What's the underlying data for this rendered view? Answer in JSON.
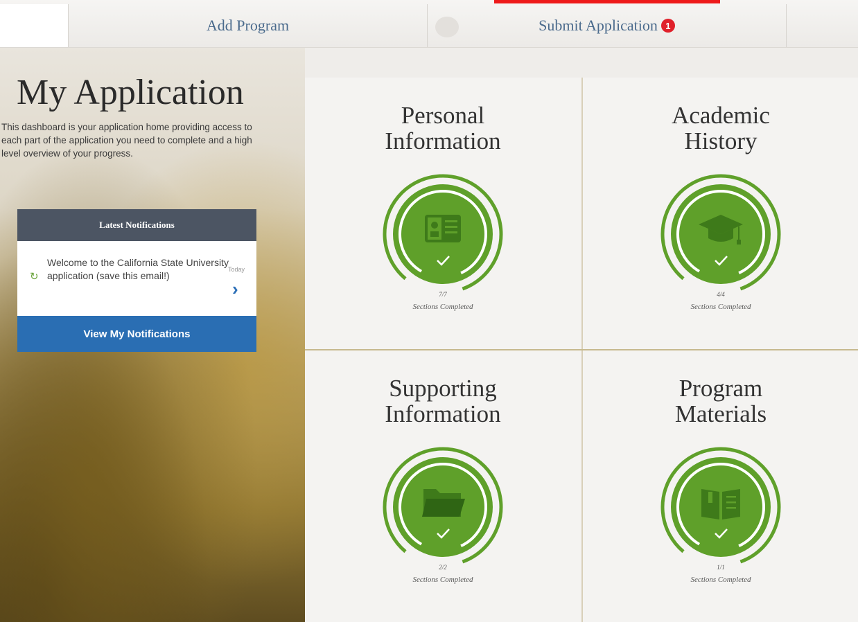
{
  "nav": {
    "tabs": [
      {
        "label": "Add Program"
      },
      {
        "label": "Submit Application",
        "badge": "1"
      }
    ],
    "highlight_color": "#ee1a1a"
  },
  "page": {
    "title": "My Application",
    "intro": "This dashboard is your application home providing access to each part of the application you need to complete and a high level overview of your progress."
  },
  "notifications": {
    "header": "Latest Notifications",
    "items": [
      {
        "text": "Welcome to the California State University application (save this email!)",
        "date": "Today",
        "icon": "refresh-icon"
      }
    ],
    "view_button": "View My Notifications"
  },
  "tiles": [
    {
      "title_line1": "Personal",
      "title_line2": "Information",
      "count": "7/7",
      "caption": "Sections Completed",
      "icon": "id-card-icon",
      "progress": 1.0
    },
    {
      "title_line1": "Academic",
      "title_line2": "History",
      "count": "4/4",
      "caption": "Sections Completed",
      "icon": "graduation-cap-icon",
      "progress": 1.0
    },
    {
      "title_line1": "Supporting",
      "title_line2": "Information",
      "count": "2/2",
      "caption": "Sections Completed",
      "icon": "folder-icon",
      "progress": 1.0
    },
    {
      "title_line1": "Program",
      "title_line2": "Materials",
      "count": "1/1",
      "caption": "Sections Completed",
      "icon": "book-icon",
      "progress": 1.0
    }
  ],
  "colors": {
    "accent_green": "#5fa02a",
    "nav_blue": "#4a6a8c",
    "button_blue": "#2a6eb3",
    "badge_red": "#e0202a"
  }
}
